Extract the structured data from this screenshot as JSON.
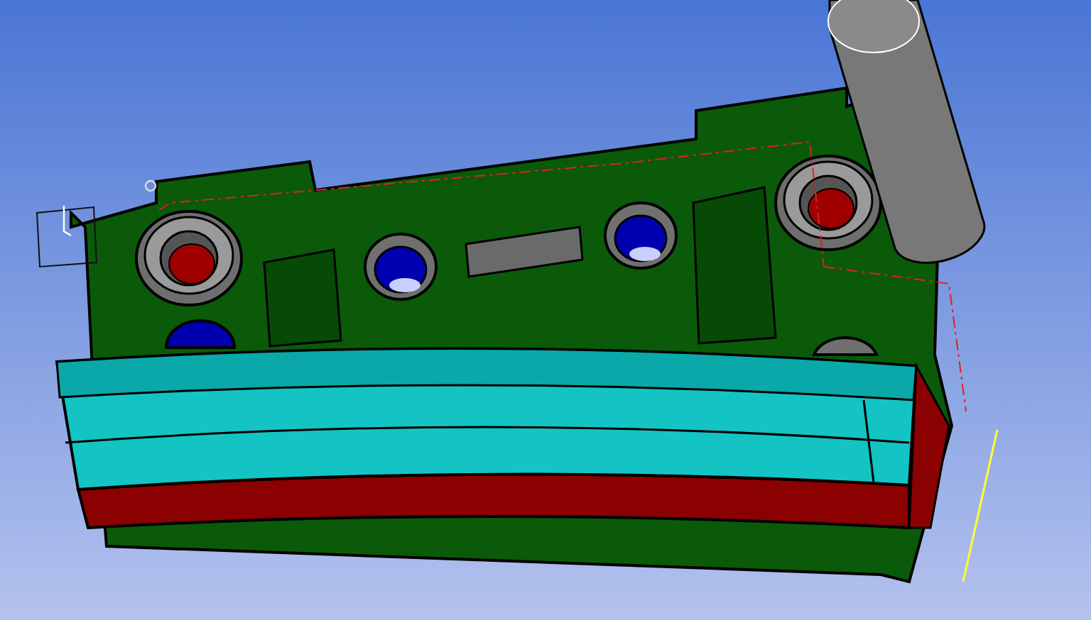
{
  "holes": [
    {
      "kind": "counterbore",
      "color": "#a00000"
    },
    {
      "kind": "counterbore",
      "color": "#a00000"
    },
    {
      "kind": "plain",
      "color": "#0000b0"
    },
    {
      "kind": "plain",
      "color": "#0000b0"
    }
  ]
}
